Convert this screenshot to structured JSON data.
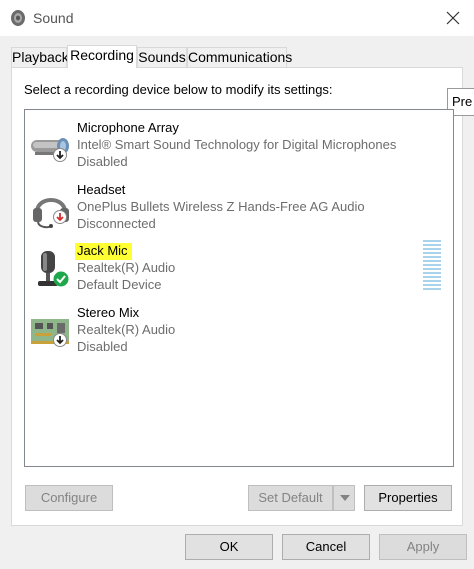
{
  "window": {
    "title": "Sound",
    "title_icon": "speaker-icon",
    "close_icon": "close-icon"
  },
  "tabs": [
    {
      "label": "Playback",
      "active": false
    },
    {
      "label": "Recording",
      "active": true
    },
    {
      "label": "Sounds",
      "active": false
    },
    {
      "label": "Communications",
      "active": false
    }
  ],
  "instruction": "Select a recording device below to modify its settings:",
  "tooltip_fragment": "Pre",
  "devices": [
    {
      "name": "Microphone Array",
      "line1": "Intel® Smart Sound Technology for Digital Microphones",
      "line2": "Disabled",
      "icon": "microphone-array-icon",
      "status_icon": "disabled-arrow-icon"
    },
    {
      "name": "Headset",
      "line1": "OnePlus Bullets Wireless Z Hands-Free AG Audio",
      "line2": "Disconnected",
      "icon": "headset-icon",
      "status_icon": "disconnected-arrow-icon"
    },
    {
      "name": "Jack Mic",
      "line1": "Realtek(R) Audio",
      "line2": "Default Device",
      "icon": "microphone-icon",
      "status_icon": "default-check-icon",
      "highlighted": true
    },
    {
      "name": "Stereo Mix",
      "line1": "Realtek(R) Audio",
      "line2": "Disabled",
      "icon": "circuit-board-icon",
      "status_icon": "disabled-arrow-icon"
    }
  ],
  "level_meter": {
    "level": 0
  },
  "buttons": {
    "configure": "Configure",
    "set_default": "Set Default",
    "properties": "Properties",
    "ok": "OK",
    "cancel": "Cancel",
    "apply": "Apply"
  },
  "colors": {
    "highlight": "#ffff33",
    "check": "#1ea84b",
    "disconnected": "#d32f2f"
  }
}
